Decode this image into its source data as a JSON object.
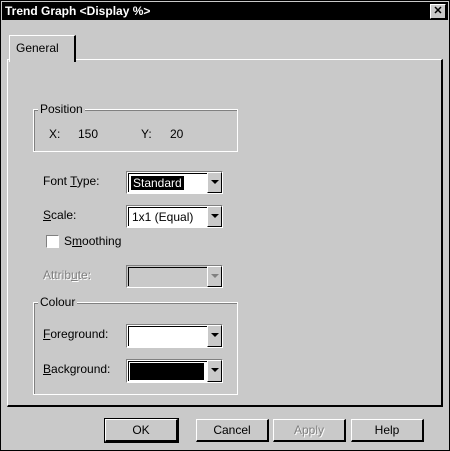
{
  "window": {
    "title": "Trend Graph <Display %>",
    "close_icon": "close-icon"
  },
  "tabs": [
    {
      "label": "General",
      "selected": true
    }
  ],
  "position": {
    "group_label": "Position",
    "x_label": "X:",
    "x_value": "150",
    "y_label": "Y:",
    "y_value": "20"
  },
  "font_type": {
    "label_pre": "Font ",
    "label_key": "T",
    "label_post": "ype:",
    "value": "Standard"
  },
  "scale": {
    "label_key": "S",
    "label_post": "cale:",
    "value": "1x1 (Equal)"
  },
  "smoothing": {
    "label_pre": "S",
    "label_key": "m",
    "label_post": "oothing",
    "checked": false
  },
  "attribute": {
    "label_pre": "Attrib",
    "label_key": "u",
    "label_post": "te:",
    "value": "",
    "enabled": false
  },
  "colour": {
    "group_label": "Colour",
    "foreground": {
      "label_key": "F",
      "label_post": "oreground:",
      "color": "#ffffff"
    },
    "background": {
      "label_key": "B",
      "label_post": "ackground:",
      "color": "#000000"
    }
  },
  "buttons": {
    "ok": "OK",
    "cancel": "Cancel",
    "apply": "Apply",
    "help": "Help"
  },
  "colors": {
    "face": "#c9c9c9",
    "title_bar": "#000000",
    "title_text": "#ffffff",
    "selected_text_bg": "#000000"
  }
}
